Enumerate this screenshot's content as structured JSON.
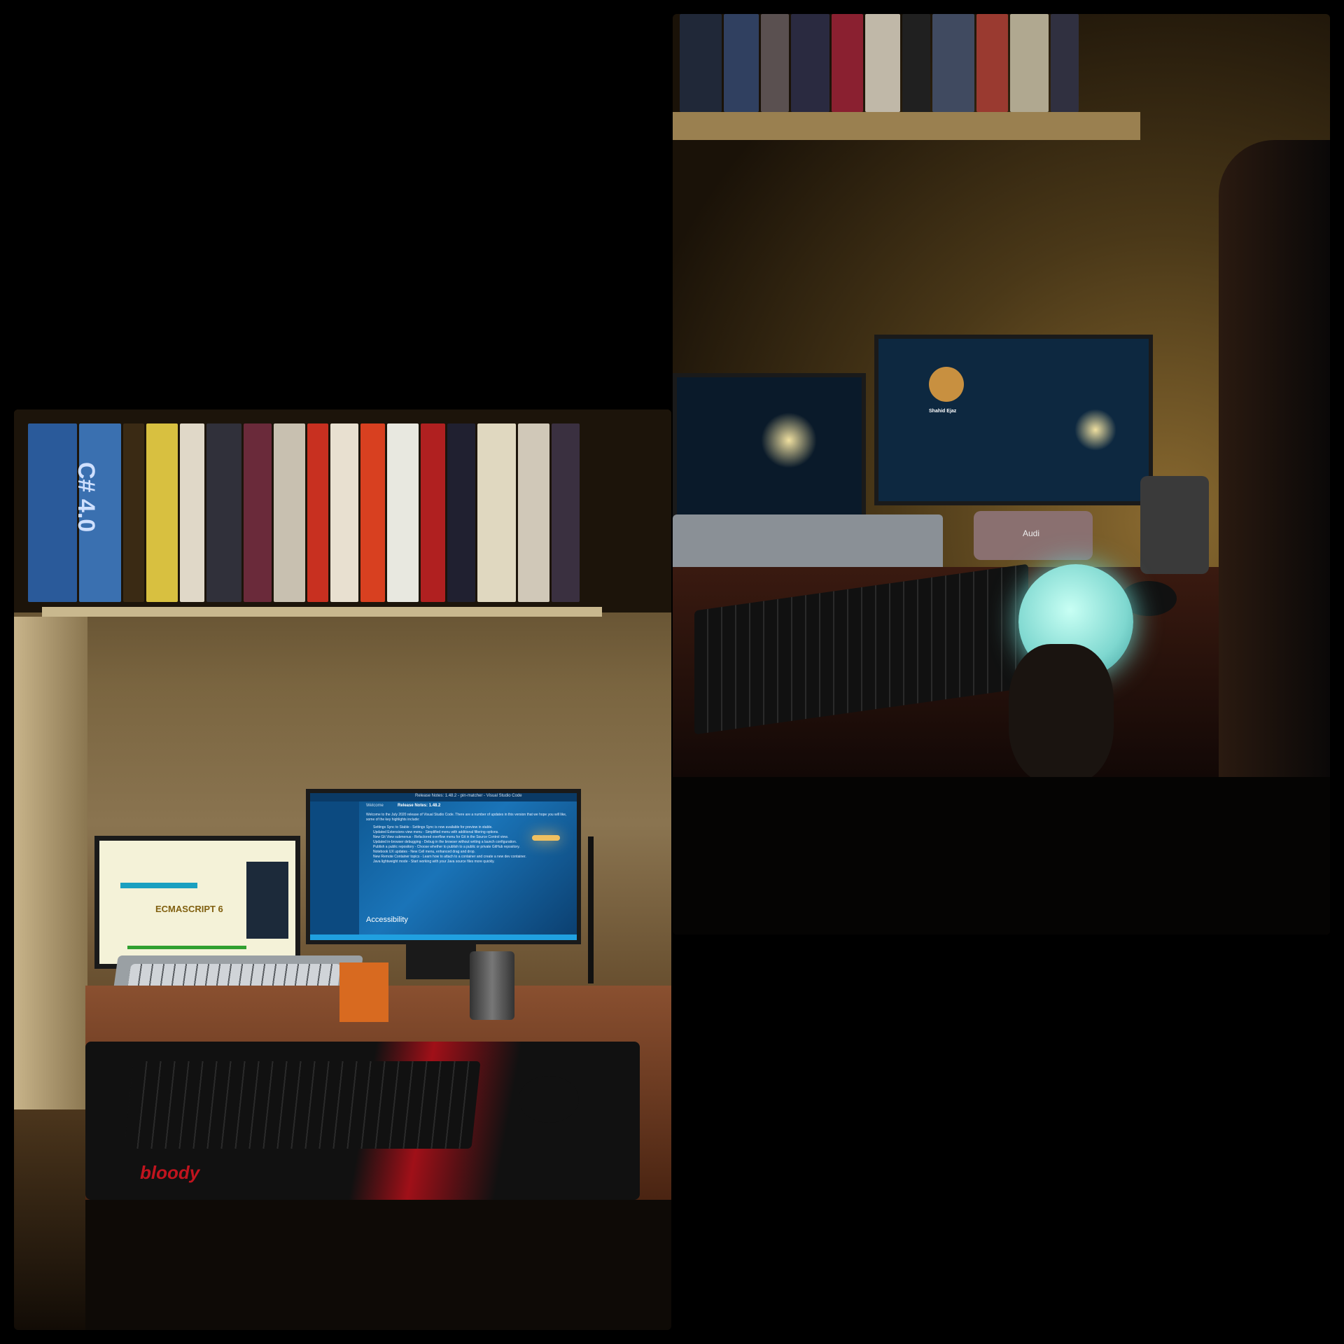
{
  "left_photo": {
    "book_spine_text": "C# 4.0",
    "laptop_screen": {
      "title": "ECMASCRIPT 6"
    },
    "monitor_screen": {
      "window_title": "Release Notes: 1.48.2 - pin-matcher - Visual Studio Code",
      "tab_welcome": "Welcome",
      "tab_release": "Release Notes: 1.48.2",
      "intro": "Welcome to the July 2020 release of Visual Studio Code. There are a number of updates in this version that we hope you will like, some of the key highlights include:",
      "bullets": [
        "Settings Sync to Stable - Settings Sync is now available for preview in stable.",
        "Updated Extensions view menu - Simplified menu with additional filtering options.",
        "New Git View submenus - Refactored overflow menu for Git in the Source Control view.",
        "Updated in-browser debugging - Debug in the browser without writing a launch configuration.",
        "Publish a public repository - Choose whether to publish to a public or private GitHub repository.",
        "Notebook UX updates - New Cell menu, enhanced drag and drop.",
        "New Remote Container topics - Learn how to attach to a container and create a new dev container.",
        "Java lightweight mode - Start working with your Java source files more quickly."
      ],
      "heading": "Accessibility"
    },
    "mousepad_brand": "bloody"
  },
  "right_photo": {
    "monitor_profile_name": "Shahid Ejaz",
    "pen_holder_brand": "Audi"
  },
  "colors": {
    "screen_blue": "#1a74b8",
    "lamp_glow": "#f0c060",
    "moon_lamp": "#9fe8e0",
    "mousepad_red": "#c0141e"
  }
}
